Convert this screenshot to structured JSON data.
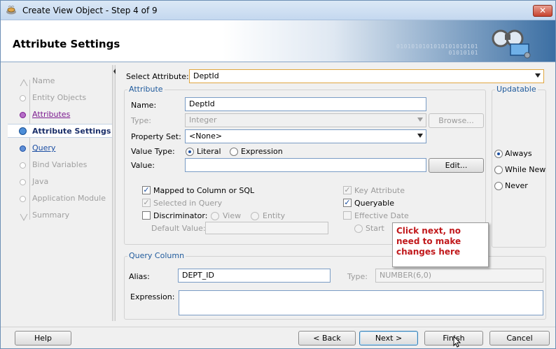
{
  "window": {
    "title": "Create View Object - Step 4 of 9",
    "close_label": "✕"
  },
  "header": {
    "title": "Attribute Settings",
    "binary_text": "0101010101010101010101\n              01010101"
  },
  "nav": {
    "items": [
      {
        "label": "Name",
        "state": "done"
      },
      {
        "label": "Entity Objects",
        "state": "done"
      },
      {
        "label": "Attributes",
        "state": "visited"
      },
      {
        "label": "Attribute Settings",
        "state": "current"
      },
      {
        "label": "Query",
        "state": "link"
      },
      {
        "label": "Bind Variables",
        "state": "pending"
      },
      {
        "label": "Java",
        "state": "pending"
      },
      {
        "label": "Application Module",
        "state": "pending"
      },
      {
        "label": "Summary",
        "state": "pending"
      }
    ]
  },
  "select_attribute": {
    "label": "Select Attribute:",
    "value": "DeptId"
  },
  "attribute": {
    "legend": "Attribute",
    "name_label": "Name:",
    "name_value": "DeptId",
    "type_label": "Type:",
    "type_value": "Integer",
    "browse_label": "Browse...",
    "property_set_label": "Property Set:",
    "property_set_value": "<None>",
    "value_type_label": "Value Type:",
    "value_type_options": [
      "Literal",
      "Expression"
    ],
    "value_type_selected": "Literal",
    "value_label": "Value:",
    "value_value": "",
    "edit_label": "Edit...",
    "mapped_label": "Mapped to Column or SQL",
    "mapped_checked": true,
    "selected_in_query_label": "Selected in Query",
    "selected_in_query_checked": true,
    "discriminator_label": "Discriminator:",
    "discriminator_checked": false,
    "disc_view_label": "View",
    "disc_entity_label": "Entity",
    "default_value_label": "Default Value:",
    "default_value_value": "",
    "key_attribute_label": "Key Attribute",
    "key_attribute_checked": true,
    "queryable_label": "Queryable",
    "queryable_checked": true,
    "effective_date_label": "Effective Date",
    "effective_date_checked": false,
    "start_label": "Start"
  },
  "updatable": {
    "legend": "Updatable",
    "options": [
      "Always",
      "While New",
      "Never"
    ],
    "selected": "Always"
  },
  "query_column": {
    "legend": "Query Column",
    "alias_label": "Alias:",
    "alias_value": "DEPT_ID",
    "type_label": "Type:",
    "type_value": "NUMBER(6,0)",
    "expression_label": "Expression:",
    "expression_value": ""
  },
  "callout": {
    "text": "Click next, no need to make changes here"
  },
  "footer": {
    "help_label": "Help",
    "back_label": "< Back",
    "next_label": "Next >",
    "finish_label": "Finish",
    "cancel_label": "Cancel"
  },
  "colors": {
    "accent": "#1f5a9c",
    "callout_text": "#c1191c",
    "visited_link": "#7b1a8f"
  }
}
